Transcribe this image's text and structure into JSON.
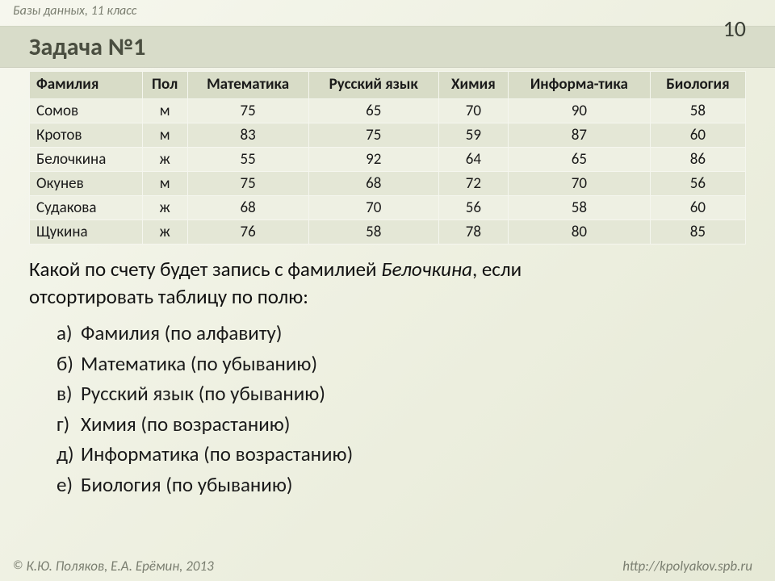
{
  "header": {
    "subject": "Базы данных, 11 класс",
    "page_number": "10"
  },
  "title": "Задача №1",
  "table": {
    "headers": [
      "Фамилия",
      "Пол",
      "Математика",
      "Русский язык",
      "Химия",
      "Информа-тика",
      "Биология"
    ],
    "rows": [
      [
        "Сомов",
        "м",
        "75",
        "65",
        "70",
        "90",
        "58"
      ],
      [
        "Кротов",
        "м",
        "83",
        "75",
        "59",
        "87",
        "60"
      ],
      [
        "Белочкина",
        "ж",
        "55",
        "92",
        "64",
        "65",
        "86"
      ],
      [
        "Окунев",
        "м",
        "75",
        "68",
        "72",
        "70",
        "56"
      ],
      [
        "Судакова",
        "ж",
        "68",
        "70",
        "56",
        "58",
        "60"
      ],
      [
        "Щукина",
        "ж",
        "76",
        "58",
        "78",
        "80",
        "85"
      ]
    ]
  },
  "question": {
    "line1_a": "Какой по счету будет запись с фамилией ",
    "line1_emph": "Белочкина",
    "line1_b": ", если",
    "line2": "отсортировать таблицу по полю:"
  },
  "options": [
    {
      "letter": "а)",
      "text": "Фамилия (по алфавиту)"
    },
    {
      "letter": "б)",
      "text": "Математика (по убыванию)"
    },
    {
      "letter": "в)",
      "text": "Русский язык  (по убыванию)"
    },
    {
      "letter": "г)",
      "text": "Химия (по возрастанию)"
    },
    {
      "letter": "д)",
      "text": "Информатика  (по возрастанию)"
    },
    {
      "letter": "е)",
      "text": "Биология  (по убыванию)"
    }
  ],
  "footer": {
    "copyright_symbol": "©",
    "copyright": "К.Ю. Поляков, Е.А. Ерёмин, 2013",
    "url": "http://kpolyakov.spb.ru"
  }
}
